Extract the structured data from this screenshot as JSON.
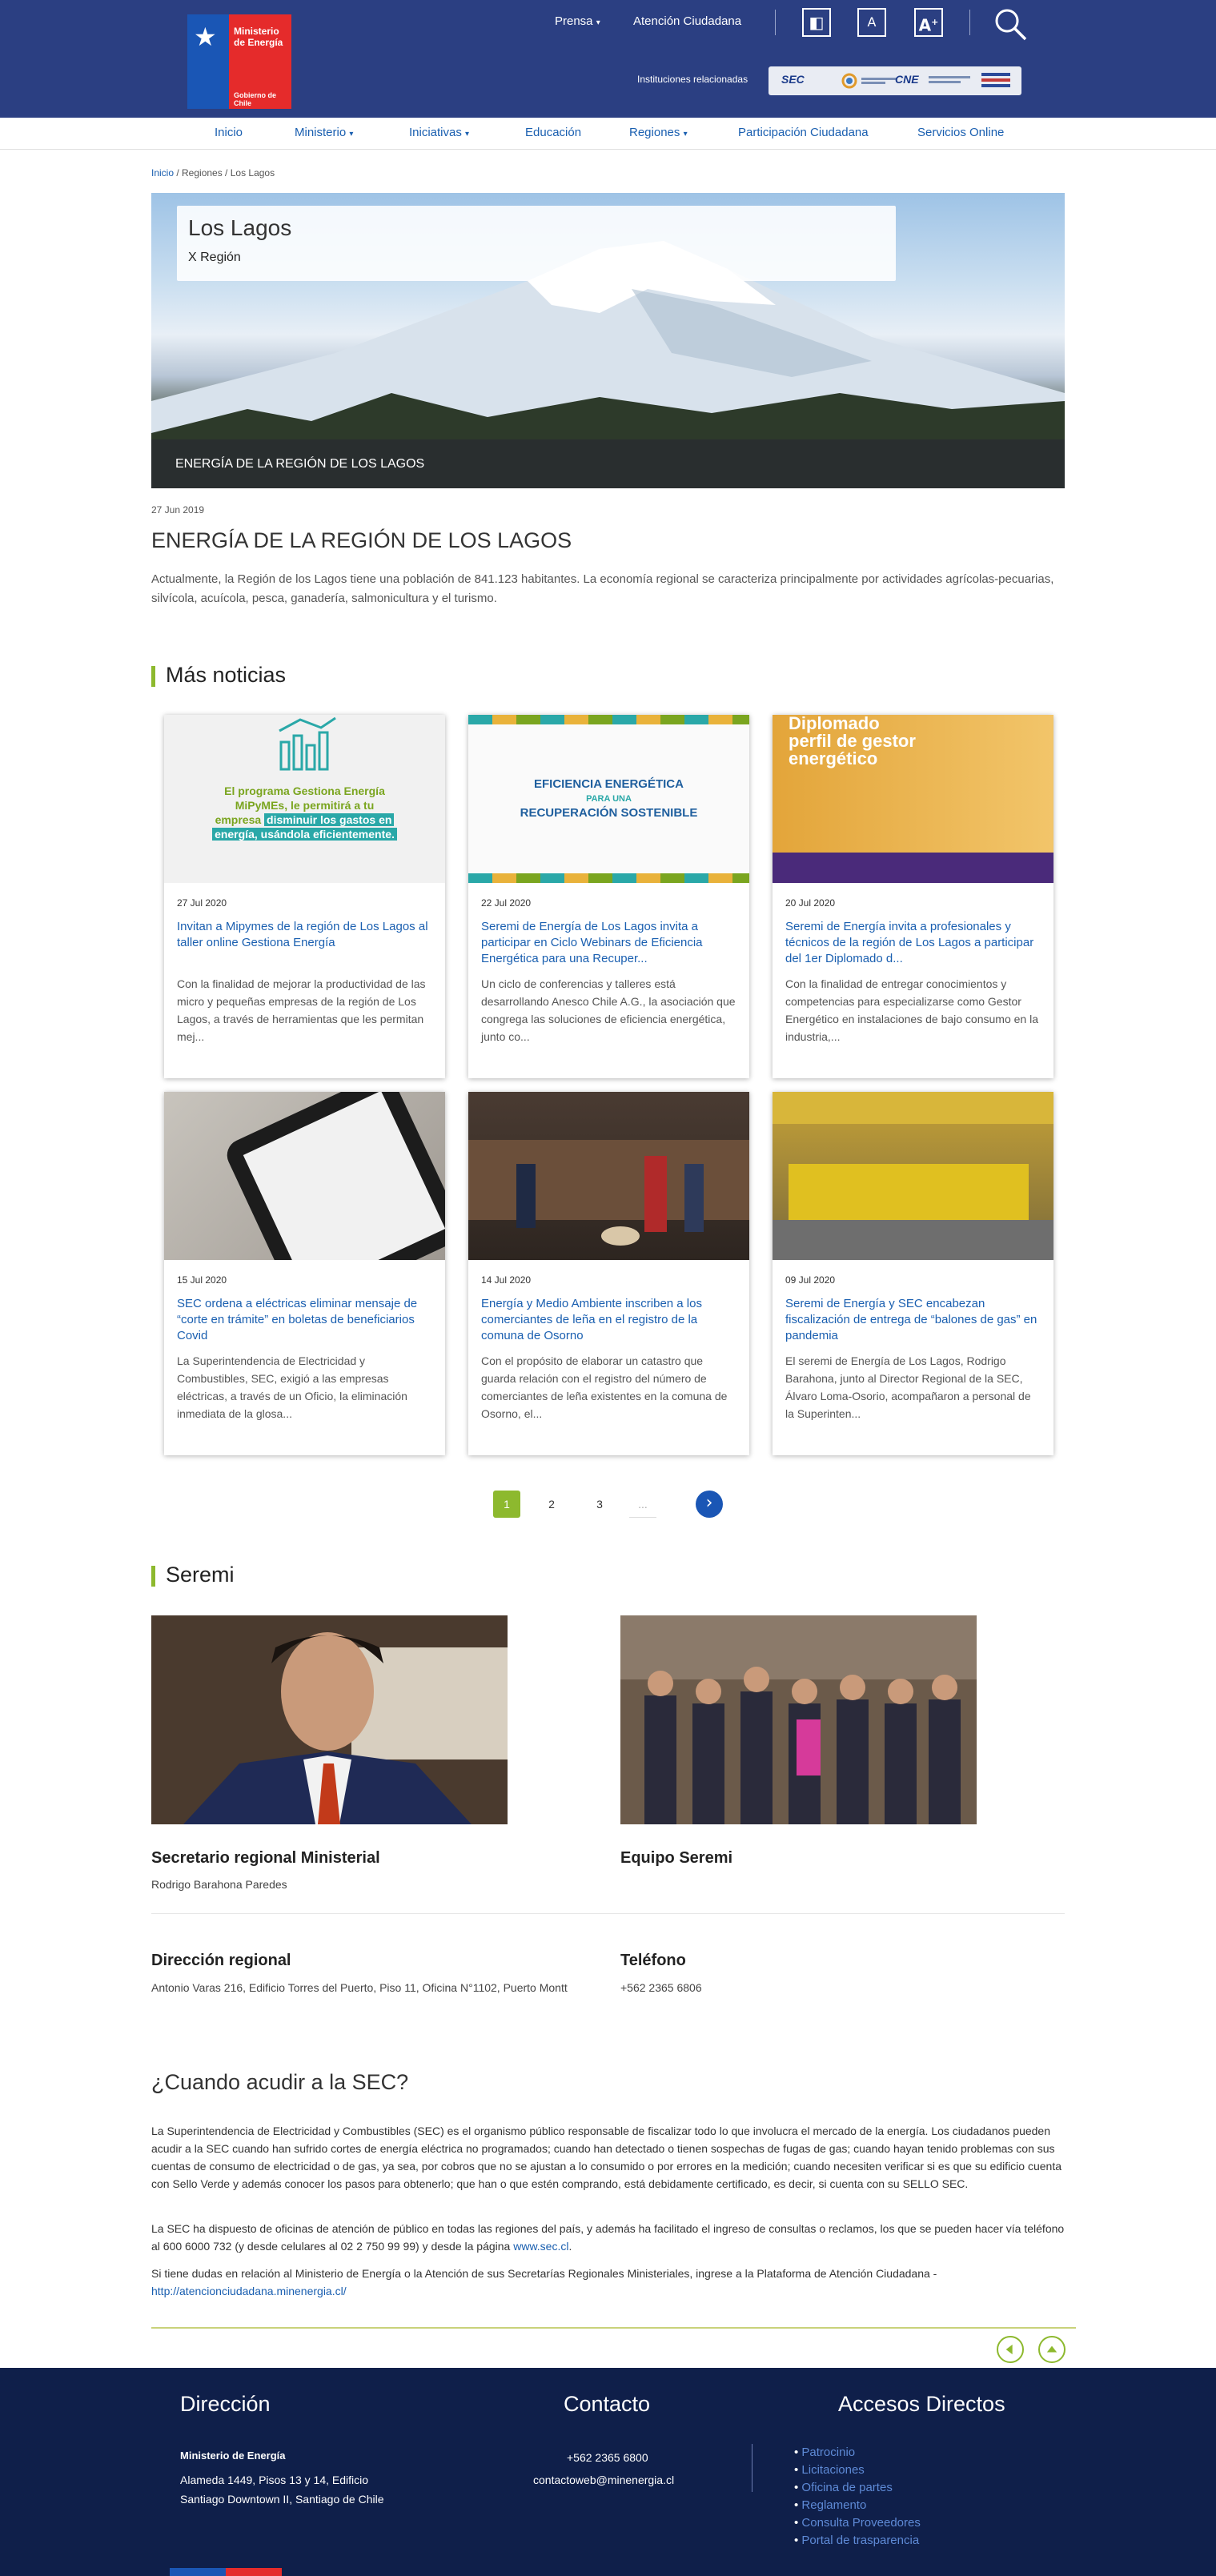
{
  "header": {
    "logo_line1": "Ministerio de Energía",
    "logo_line2": "Gobierno de Chile",
    "prensa": "Prensa",
    "atencion": "Atención Ciudadana",
    "font_small": "A",
    "font_large": "A",
    "instituciones": "Instituciones relacionadas",
    "inst_logos": [
      "SEC",
      "CNE"
    ]
  },
  "mainnav": [
    "Inicio",
    "Ministerio",
    "Iniciativas",
    "Educación",
    "Regiones",
    "Participación Ciudadana",
    "Servicios Online"
  ],
  "breadcrumb": {
    "home": "Inicio",
    "rest": " / Regiones / Los Lagos"
  },
  "hero": {
    "title": "Los Lagos",
    "subtitle": "X Región",
    "caption": "ENERGÍA DE LA REGIÓN DE LOS LAGOS"
  },
  "article": {
    "date": "27 Jun 2019",
    "title": "ENERGÍA DE LA REGIÓN DE LOS LAGOS",
    "body": "Actualmente, la Región de los Lagos tiene una población de 841.123 habitantes. La economía regional se caracteriza principalmente por actividades agrícolas-pecuarias, silvícola, acuícola, pesca, ganadería, salmonicultura y el turismo."
  },
  "news_heading": "Más noticias",
  "news": [
    {
      "date": "27 Jul 2020",
      "title": "Invitan a Mipymes de la región de Los Lagos al taller online Gestiona Energía",
      "body": "Con la finalidad de mejorar la productividad de las micro y pequeñas empresas de la región de Los Lagos, a través de herramientas que les permitan mej..."
    },
    {
      "date": "22 Jul 2020",
      "title": "Seremi de Energía de Los Lagos invita a participar en Ciclo Webinars de Eficiencia Energética para una Recuper...",
      "body": "Un ciclo de conferencias y talleres está desarrollando Anesco Chile A.G., la asociación que congrega las soluciones de eficiencia energética, junto co..."
    },
    {
      "date": "20 Jul 2020",
      "title": "Seremi de Energía invita a profesionales y técnicos de la región de Los Lagos a participar del 1er Diplomado d...",
      "body": "Con la finalidad de entregar conocimientos y competencias para especializarse como Gestor Energético en instalaciones de bajo consumo en la industria,..."
    },
    {
      "date": "15 Jul 2020",
      "title": "SEC ordena a eléctricas eliminar mensaje de “corte en trámite” en boletas de beneficiarios Covid",
      "body": "La Superintendencia de Electricidad y Combustibles, SEC, exigió a las empresas eléctricas, a través de un Oficio, la eliminación inmediata de la glosa..."
    },
    {
      "date": "14 Jul 2020",
      "title": "Energía y Medio Ambiente inscriben a los comerciantes de leña en el registro de la comuna de Osorno",
      "body": "Con el propósito de elaborar un catastro que guarda relación con el registro del número de comerciantes de leña existentes en la comuna de Osorno, el..."
    },
    {
      "date": "09 Jul 2020",
      "title": "Seremi de Energía y SEC encabezan fiscalización de entrega de “balones de gas” en pandemia",
      "body": "El seremi de Energía de Los Lagos, Rodrigo Barahona, junto al Director Regional de la SEC, Álvaro Loma-Osorio, acompañaron a personal de la Superinten..."
    }
  ],
  "card_texts": {
    "c1_line1": "El programa Gestiona Energía",
    "c1_line2": "MiPyMEs, le permitirá a tu",
    "c1_line3": "empresa",
    "c1_hl1": "disminuir los gastos en",
    "c1_hl2": "energía, usándola eficientemente.",
    "c2_t1": "EFICIENCIA ENERGÉTICA",
    "c2_t2": "PARA UNA",
    "c2_t3": "RECUPERACIÓN SOSTENIBLE",
    "c3_t1": "Diplomado",
    "c3_t2": "perfil de gestor",
    "c3_t3": "energético"
  },
  "pagination": [
    "1",
    "2",
    "3",
    "..."
  ],
  "seremi_heading": "Seremi",
  "seremi": {
    "role": "Secretario regional Ministerial",
    "name": "Rodrigo Barahona Paredes",
    "team": "Equipo Seremi",
    "dir_label": "Dirección regional",
    "dir_value": "Antonio Varas 216, Edificio Torres del Puerto, Piso 11, Oficina N°1102, Puerto Montt",
    "tel_label": "Teléfono",
    "tel_value": "+562 2365 6806"
  },
  "when": {
    "title": "¿Cuando acudir a la SEC?",
    "p1": "La Superintendencia de Electricidad y Combustibles (SEC) es el organismo público responsable de fiscalizar todo lo que involucra el mercado de la energía. Los ciudadanos pueden acudir a la SEC cuando han sufrido cortes de energía eléctrica no programados; cuando han detectado o tienen sospechas de fugas de gas; cuando hayan tenido problemas con sus cuentas de consumo de electricidad o de gas, ya sea, por cobros que no se ajustan a lo consumido o por errores en la medición; cuando necesiten verificar si es que su edificio cuenta con Sello Verde y además conocer los pasos para obtenerlo; que han o que estén comprando, está debidamente certificado, es decir, si cuenta con su SELLO SEC.",
    "p2": "La SEC ha dispuesto de oficinas de atención de público en todas las regiones del país, y además ha facilitado el ingreso de consultas o reclamos, los que se pueden hacer vía teléfono al 600 6000 732 (y desde celulares al 02 2 750 99 99) y desde la página ",
    "p2_link": "www.sec.cl",
    "p2_end": ".",
    "p3": "Si tiene dudas en relación al Ministerio de Energía o la Atención de sus Secretarías Regionales Ministeriales, ingrese a la Plataforma de Atención Ciudadana - ",
    "p3_link": "http://atencionciudadana.minenergia.cl/"
  },
  "footer": {
    "dir_h": "Dirección",
    "dir_l1": "Ministerio de Energía",
    "dir_l2": "Alameda 1449, Pisos 13 y 14, Edificio",
    "dir_l3": "Santiago Downtown II, Santiago de Chile",
    "con_h": "Contacto",
    "phone": "+562 2365 6800",
    "email": "contactoweb@minenergia.cl",
    "acc_h": "Accesos Directos",
    "links": [
      "Patrocinio",
      "Licitaciones",
      "Oficina de partes",
      "Reglamento",
      "Consulta Proveedores",
      "Portal de trasparencia"
    ]
  },
  "colors": {
    "header_bg": "#2b3f82",
    "accent_green": "#8db92e",
    "link_blue": "#1a5fb0",
    "footer_bg": "#0f1f4a"
  }
}
